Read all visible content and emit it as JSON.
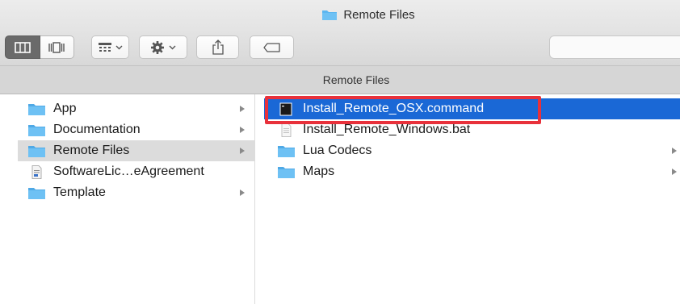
{
  "window": {
    "title": "Remote Files",
    "title_icon": "folder-icon"
  },
  "toolbar": {
    "view_buttons": [
      "column-view-icon",
      "cover-flow-view-icon"
    ],
    "arrange_icon": "grid-arrange-icon",
    "action_icon": "gear-icon",
    "share_icon": "share-icon",
    "tag_icon": "tag-icon",
    "search": {
      "placeholder": ""
    }
  },
  "path_bar": {
    "label": "Remote Files"
  },
  "column1": {
    "items": [
      {
        "label": "App",
        "icon": "folder-icon",
        "has_children": true,
        "selected": false
      },
      {
        "label": "Documentation",
        "icon": "folder-icon",
        "has_children": true,
        "selected": false
      },
      {
        "label": "Remote Files",
        "icon": "folder-icon",
        "has_children": true,
        "selected": true
      },
      {
        "label": "SoftwareLic…eAgreement",
        "icon": "document-icon",
        "has_children": false,
        "selected": false
      },
      {
        "label": "Template",
        "icon": "folder-icon",
        "has_children": true,
        "selected": false
      }
    ]
  },
  "column2": {
    "items": [
      {
        "label": "Install_Remote_OSX.command",
        "icon": "terminal-icon",
        "has_children": false,
        "selected": true
      },
      {
        "label": "Install_Remote_Windows.bat",
        "icon": "text-file-icon",
        "has_children": false,
        "selected": false
      },
      {
        "label": "Lua Codecs",
        "icon": "folder-icon",
        "has_children": true,
        "selected": false
      },
      {
        "label": "Maps",
        "icon": "folder-icon",
        "has_children": true,
        "selected": false
      }
    ]
  },
  "colors": {
    "selection_blue": "#1a68d6",
    "folder_blue": "#5cb6f0",
    "highlight_red": "#e8313b",
    "inactive_selection": "#dcdcdc"
  }
}
